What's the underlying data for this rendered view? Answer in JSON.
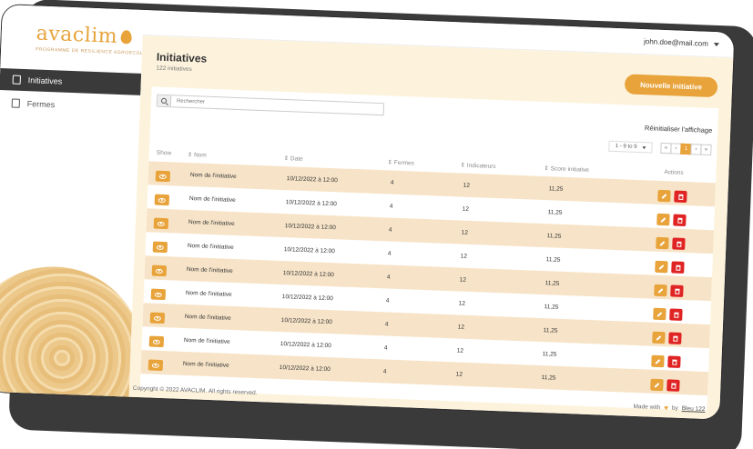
{
  "app": {
    "logo": "avaclim",
    "logo_tagline": "PROGRAMME DE RESILIENCE AGROECOLOGIQUE"
  },
  "sidebar": {
    "items": [
      {
        "label": "Initiatives",
        "active": true,
        "icon": "document-icon"
      },
      {
        "label": "Fermes",
        "active": false,
        "icon": "farm-icon"
      }
    ]
  },
  "topbar": {
    "user_email": "john.doe@mail.com"
  },
  "page": {
    "title": "Initiatives",
    "count_label": "122 initiatives",
    "new_button": "Nouvelle initiative",
    "reset_label": "Réinitialiser l'affichage"
  },
  "search": {
    "placeholder": "Rechercher"
  },
  "pagination": {
    "range_label": "1 - 9 to 9",
    "first": "«",
    "prev": "‹",
    "current": "1",
    "next": "›",
    "last": "»"
  },
  "table": {
    "headers": {
      "show": "Show",
      "name": "Nom",
      "date": "Date",
      "farms": "Fermes",
      "indicators": "Indicateurs",
      "score": "Score initiative",
      "actions": "Actions"
    },
    "rows": [
      {
        "name": "Nom de l'initiative",
        "date": "10/12/2022 à 12:00",
        "farms": "4",
        "indicators": "12",
        "score": "11,25"
      },
      {
        "name": "Nom de l'initiative",
        "date": "10/12/2022 à 12:00",
        "farms": "4",
        "indicators": "12",
        "score": "11,25"
      },
      {
        "name": "Nom de l'initiative",
        "date": "10/12/2022 à 12:00",
        "farms": "4",
        "indicators": "12",
        "score": "11,25"
      },
      {
        "name": "Nom de l'initiative",
        "date": "10/12/2022 à 12:00",
        "farms": "4",
        "indicators": "12",
        "score": "11,25"
      },
      {
        "name": "Nom de l'initiative",
        "date": "10/12/2022 à 12:00",
        "farms": "4",
        "indicators": "12",
        "score": "11,25"
      },
      {
        "name": "Nom de l'initiative",
        "date": "10/12/2022 à 12:00",
        "farms": "4",
        "indicators": "12",
        "score": "11,25"
      },
      {
        "name": "Nom de l'initiative",
        "date": "10/12/2022 à 12:00",
        "farms": "4",
        "indicators": "12",
        "score": "11,25"
      },
      {
        "name": "Nom de l'initiative",
        "date": "10/12/2022 à 12:00",
        "farms": "4",
        "indicators": "12",
        "score": "11,25"
      },
      {
        "name": "Nom de l'initiative",
        "date": "10/12/2022 à 12:00",
        "farms": "4",
        "indicators": "12",
        "score": "11,25"
      }
    ]
  },
  "footer": {
    "copyright": "Copyright © 2022 AVACLIM. All rights reserved.",
    "made_with": "Made with",
    "by": "by",
    "author": "Bleu 122"
  },
  "colors": {
    "accent": "#e8a33a",
    "danger": "#e02424",
    "dark": "#3a3a3a",
    "background": "#fdf3dd"
  }
}
